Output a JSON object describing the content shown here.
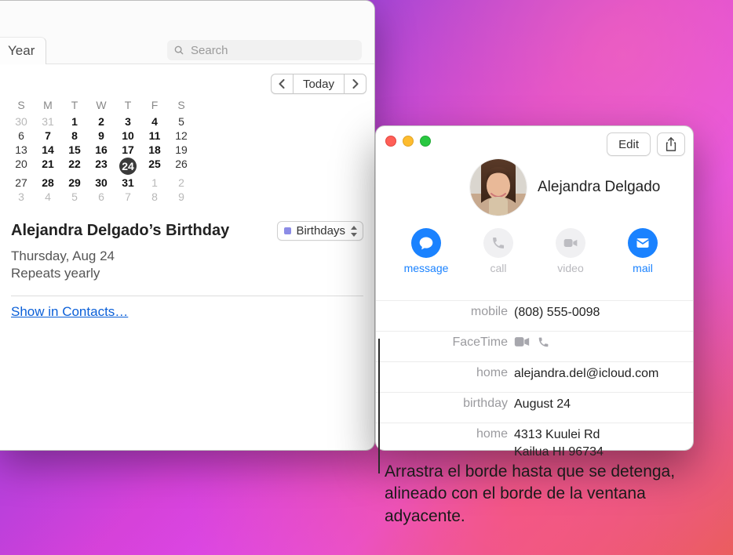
{
  "calendar": {
    "year_tab": "Year",
    "search_placeholder": "Search",
    "today_label": "Today",
    "dow": [
      "S",
      "M",
      "T",
      "W",
      "T",
      "F",
      "S"
    ],
    "grid": [
      [
        {
          "d": 30,
          "o": true
        },
        {
          "d": 31,
          "o": true
        },
        {
          "d": 1,
          "b": true
        },
        {
          "d": 2,
          "b": true
        },
        {
          "d": 3,
          "b": true
        },
        {
          "d": 4,
          "b": true
        },
        {
          "d": 5
        }
      ],
      [
        {
          "d": 6
        },
        {
          "d": 7,
          "b": true
        },
        {
          "d": 8,
          "b": true
        },
        {
          "d": 9,
          "b": true
        },
        {
          "d": 10,
          "b": true
        },
        {
          "d": 11,
          "b": true
        },
        {
          "d": 12
        }
      ],
      [
        {
          "d": 13
        },
        {
          "d": 14,
          "b": true
        },
        {
          "d": 15,
          "b": true
        },
        {
          "d": 16,
          "b": true
        },
        {
          "d": 17,
          "b": true
        },
        {
          "d": 18,
          "b": true
        },
        {
          "d": 19
        }
      ],
      [
        {
          "d": 20
        },
        {
          "d": 21,
          "b": true
        },
        {
          "d": 22,
          "b": true
        },
        {
          "d": 23,
          "b": true
        },
        {
          "d": 24,
          "b": true,
          "sel": true
        },
        {
          "d": 25,
          "b": true
        },
        {
          "d": 26
        }
      ],
      [
        {
          "d": 27
        },
        {
          "d": 28,
          "b": true
        },
        {
          "d": 29,
          "b": true
        },
        {
          "d": 30,
          "b": true
        },
        {
          "d": 31,
          "b": true
        },
        {
          "d": 1,
          "o": true
        },
        {
          "d": 2,
          "o": true
        }
      ],
      [
        {
          "d": 3,
          "o": true
        },
        {
          "d": 4,
          "o": true
        },
        {
          "d": 5,
          "o": true
        },
        {
          "d": 6,
          "o": true
        },
        {
          "d": 7,
          "o": true
        },
        {
          "d": 8,
          "o": true
        },
        {
          "d": 9,
          "o": true
        }
      ]
    ],
    "event": {
      "title": "Alejandra Delgado’s Birthday",
      "calendar_name": "Birthdays",
      "date_line": "Thursday, Aug 24",
      "repeat_line": "Repeats yearly",
      "show_link": "Show in Contacts…"
    }
  },
  "contact": {
    "edit_label": "Edit",
    "name": "Alejandra Delgado",
    "actions": {
      "message": "message",
      "call": "call",
      "video": "video",
      "mail": "mail"
    },
    "fields": {
      "mobile_label": "mobile",
      "mobile_value": "(808) 555-0098",
      "facetime_label": "FaceTime",
      "home_email_label": "home",
      "home_email_value": "alejandra.del@icloud.com",
      "birthday_label": "birthday",
      "birthday_value": "August 24",
      "home_addr_label": "home",
      "home_addr_value": "4313 Kuulei Rd\nKailua HI 96734"
    }
  },
  "callout": "Arrastra el borde hasta que se detenga, alineado con el borde de la ventana adyacente."
}
